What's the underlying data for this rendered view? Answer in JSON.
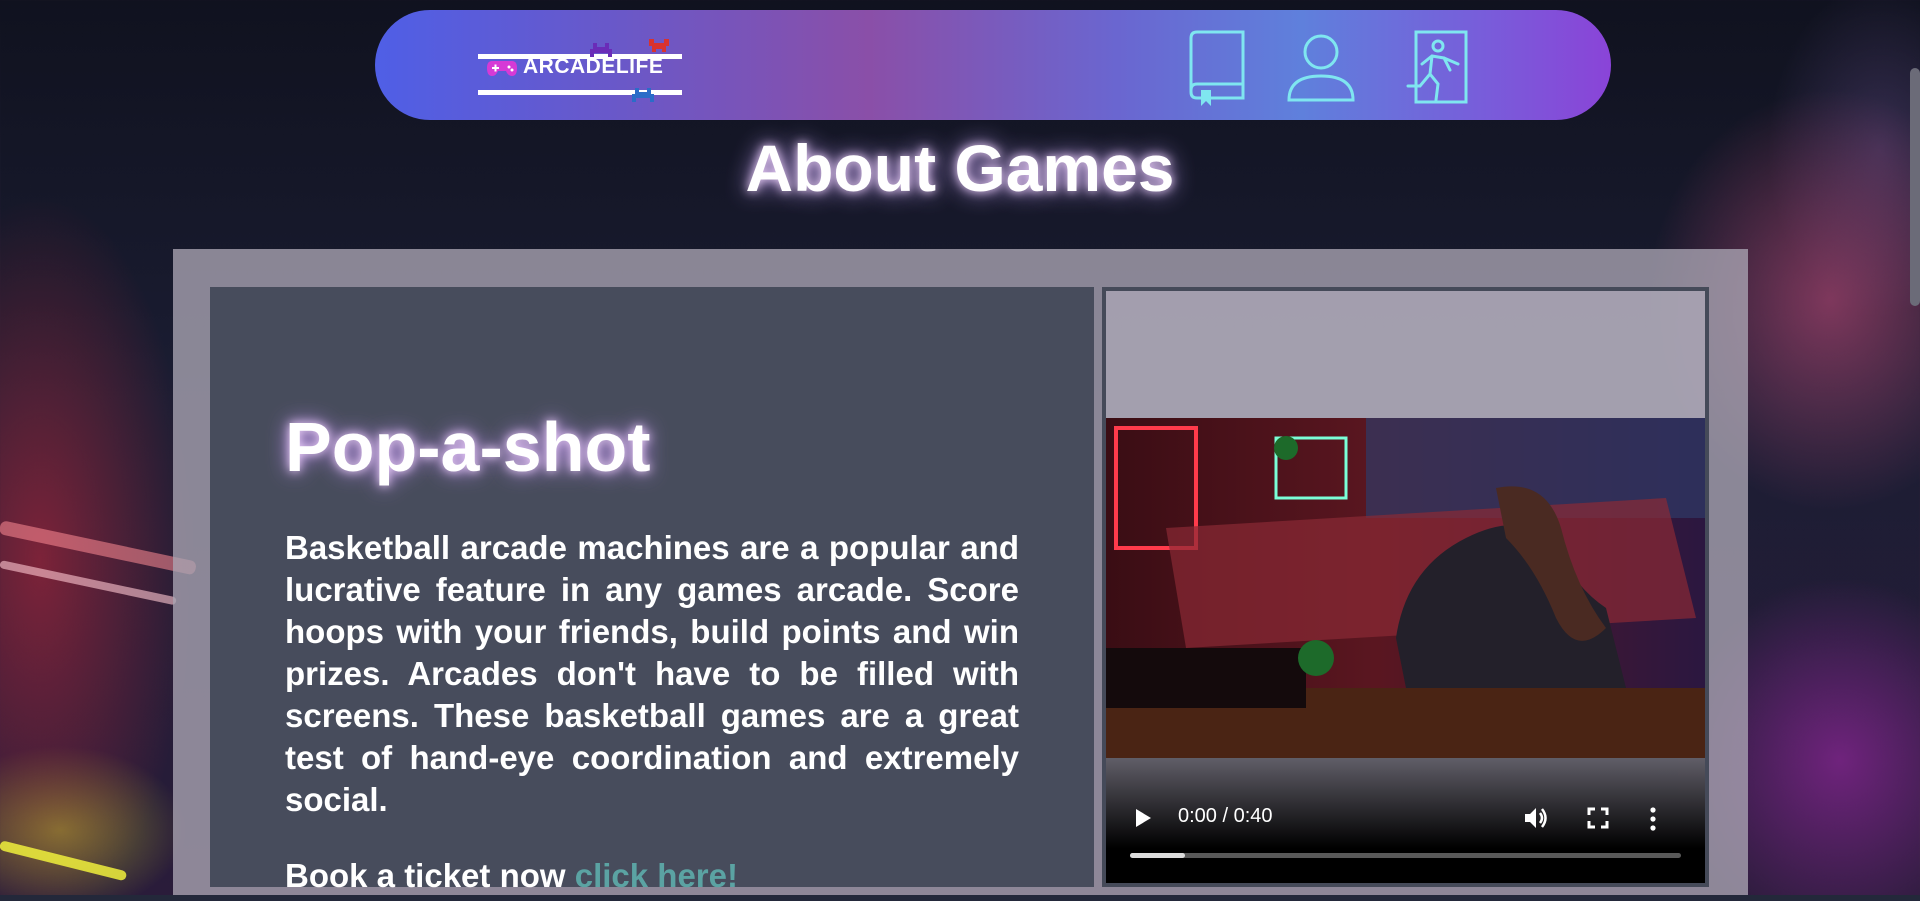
{
  "header": {
    "logo_text": "ARCADELIFE",
    "icons": [
      "book-icon",
      "user-icon",
      "exit-icon"
    ]
  },
  "page": {
    "title": "About Games"
  },
  "game": {
    "title": "Pop-a-shot",
    "description": "Basketball arcade machines are a popular and lucrative feature in any games arcade. Score hoops with your friends, build points and win prizes. Arcades don't have to be filled with screens. These basketball games are a great test of hand-eye coordination and extremely social.",
    "book_prefix": "Book a ticket now ",
    "book_link": "click here!"
  },
  "video": {
    "time": "0:00 / 0:40",
    "progress": 0.1,
    "icons": [
      "play-icon",
      "volume-icon",
      "fullscreen-icon",
      "more-options-icon"
    ]
  },
  "colors": {
    "nav_start": "#4f5fe6",
    "nav_end": "#8a44d8",
    "link": "#5ba3a3",
    "icon_stroke": "#7fe6f0"
  }
}
